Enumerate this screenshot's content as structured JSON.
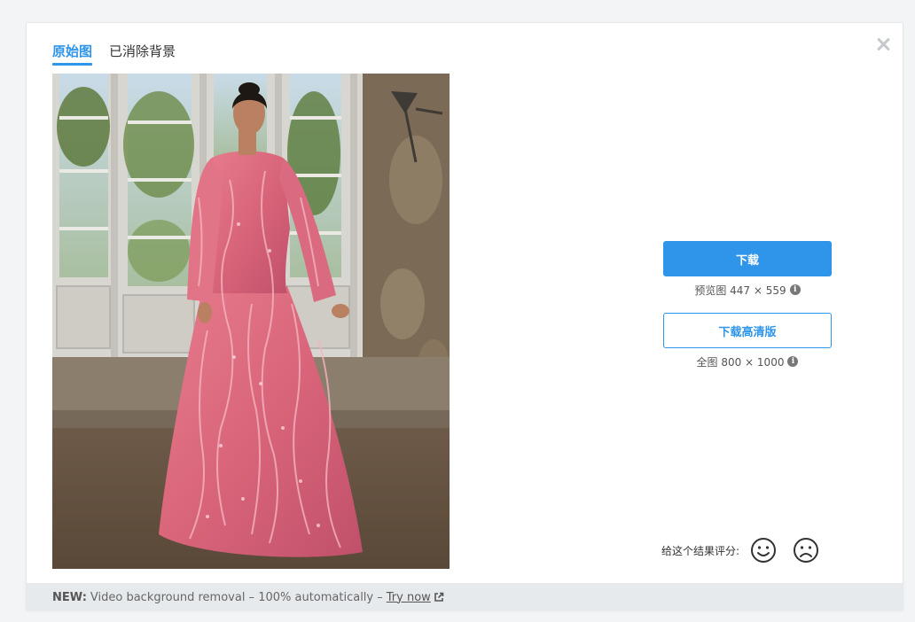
{
  "tabs": [
    {
      "label": "原始图",
      "active": true
    },
    {
      "label": "已消除背景",
      "active": false
    }
  ],
  "preview": {
    "download_label": "下载",
    "preview_text": "预览图 447 × 559",
    "hd_label": "下载高清版",
    "full_text": "全图 800 × 1000"
  },
  "rating": {
    "label": "给这个结果评分:",
    "happy_icon": "smile-icon",
    "sad_icon": "frown-icon"
  },
  "footer": {
    "new_label": "NEW:",
    "text": "Video background removal – 100% automatically –",
    "link": "Try now"
  },
  "colors": {
    "accent": "#2f95ea",
    "dress": "#d9657a"
  }
}
